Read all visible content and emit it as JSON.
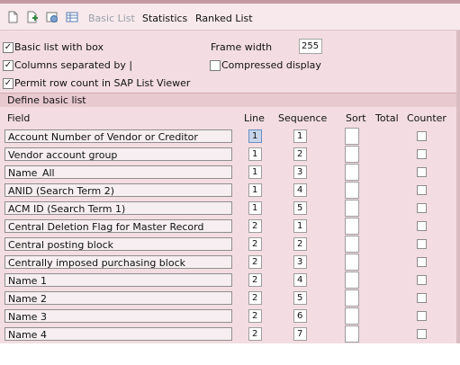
{
  "toolbar": {
    "items": [
      {
        "label": "Basic List",
        "enabled": false
      },
      {
        "label": "Statistics",
        "enabled": true
      },
      {
        "label": "Ranked List",
        "enabled": true
      }
    ]
  },
  "options": {
    "basic_list_with_box": {
      "label": "Basic list with box",
      "checked": true
    },
    "columns_separated": {
      "label": "Columns separated by |",
      "checked": true
    },
    "permit_row_count": {
      "label": "Permit row count in SAP List Viewer",
      "checked": true
    },
    "frame_width": {
      "label": "Frame width",
      "value": "255"
    },
    "compressed_display": {
      "label": "Compressed display",
      "checked": false
    }
  },
  "section": {
    "title": "Define basic list"
  },
  "table": {
    "headers": {
      "field": "Field",
      "line": "Line",
      "sequence": "Sequence",
      "sort": "Sort",
      "total": "Total",
      "counter": "Counter"
    },
    "rows": [
      {
        "field": "Account Number of Vendor or Creditor",
        "line": "1",
        "sequence": "1"
      },
      {
        "field": "Vendor account group",
        "line": "1",
        "sequence": "2"
      },
      {
        "field": "Name_All",
        "line": "1",
        "sequence": "3"
      },
      {
        "field": "ANID (Search Term 2)",
        "line": "1",
        "sequence": "4"
      },
      {
        "field": "ACM ID (Search Term 1)",
        "line": "1",
        "sequence": "5"
      },
      {
        "field": "Central Deletion Flag for Master Record",
        "line": "2",
        "sequence": "1"
      },
      {
        "field": "Central posting block",
        "line": "2",
        "sequence": "2"
      },
      {
        "field": "Centrally imposed purchasing block",
        "line": "2",
        "sequence": "3"
      },
      {
        "field": "Name 1",
        "line": "2",
        "sequence": "4"
      },
      {
        "field": "Name 2",
        "line": "2",
        "sequence": "5"
      },
      {
        "field": "Name 3",
        "line": "2",
        "sequence": "6"
      },
      {
        "field": "Name 4",
        "line": "2",
        "sequence": "7"
      }
    ]
  },
  "colors": {
    "toolbar_bg": "#f7e9ec",
    "panel_bg": "#f3dde2",
    "section_bg": "#e8c9cf",
    "focus_cell": "#c6d5ea"
  }
}
